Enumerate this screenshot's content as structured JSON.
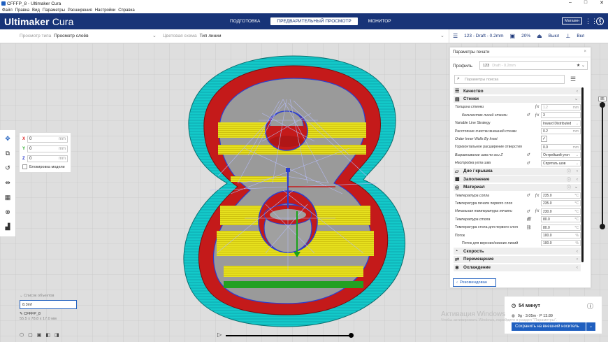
{
  "window": {
    "title": "CFFFP_8 - Ultimaker Cura",
    "controls": [
      "–",
      "□",
      "✕"
    ]
  },
  "menu": [
    "Файл",
    "Правка",
    "Вид",
    "Параметры",
    "Расширения",
    "Настройки",
    "Справка"
  ],
  "header": {
    "brand_main": "Ultimaker",
    "brand_sub": " Cura",
    "tabs": [
      "ПОДГОТОВКА",
      "ПРЕДВАРИТЕЛЬНЫЙ ПРОСМОТР",
      "МОНИТОР"
    ],
    "active_tab": 1,
    "marketplace": "Магазин",
    "account_initial": "E"
  },
  "toolbar": {
    "view_label": "Просмотр типа",
    "view_value": "Просмотр слоёв",
    "scheme_label": "Цветовая схема",
    "scheme_value": "Тип линии",
    "profile": "123 - Draft - 0.2mm",
    "infill": "20%",
    "support": "Выкл",
    "adhesion": "Вкл"
  },
  "move": {
    "x": "0",
    "y": "0",
    "z": "0",
    "unit": "mm",
    "lock_label": "Блокировка модели"
  },
  "objects": {
    "header": "Список объектов",
    "file": "8.3mf",
    "name": "CFFFP_8",
    "dims": "55.5 x 78.8 x 17.0 мм"
  },
  "layer_top": "85",
  "settings": {
    "title": "Параметры печати",
    "profile_label": "Профиль",
    "profile_value": "123",
    "profile_extra": "Draft - 0.2mm",
    "search_placeholder": "Параметры поиска",
    "recommended": "Рекомендован",
    "rows": [
      {
        "type": "cat",
        "icon": "☰",
        "label": "Качество"
      },
      {
        "type": "cat",
        "icon": "▤",
        "label": "Стенки",
        "open": true
      },
      {
        "type": "row",
        "label": "Толщина стенки",
        "italic": true,
        "fx": true,
        "value": "1.2",
        "unit": "mm",
        "disabled": true
      },
      {
        "type": "row",
        "label": "Количество линий стенки",
        "italic": true,
        "indent": true,
        "reset": true,
        "fx": true,
        "value": "3",
        "unit": ""
      },
      {
        "type": "row",
        "label": "Variable Line Strategy",
        "value": "Inward Distributed",
        "unit": "⌄"
      },
      {
        "type": "row",
        "label": "Расстояние очистки внешней стенки",
        "value": "0.2",
        "unit": "mm"
      },
      {
        "type": "row",
        "label": "Order Inner Walls By Inset",
        "italic": true,
        "check": true
      },
      {
        "type": "row",
        "label": "Горизонтальное расширение отверстия",
        "value": "0.0",
        "unit": "mm"
      },
      {
        "type": "row",
        "label": "Выравнивание шва по оси Z",
        "italic": true,
        "reset": true,
        "value": "Острейший угол",
        "unit": "⌄"
      },
      {
        "type": "row",
        "label": "Настройка угла шва",
        "italic": true,
        "reset": true,
        "value": "Спрятать шов",
        "unit": "⌄"
      },
      {
        "type": "cat",
        "icon": "▱",
        "label": "Дно / крышка",
        "info": true
      },
      {
        "type": "cat",
        "icon": "▩",
        "label": "Заполнение",
        "info": true
      },
      {
        "type": "cat",
        "icon": "◎",
        "label": "Материал",
        "info": true,
        "open": true
      },
      {
        "type": "row",
        "label": "Температура сопла",
        "italic": true,
        "reset": true,
        "fx": true,
        "value": "235.0",
        "unit": "°C"
      },
      {
        "type": "row",
        "label": "Температура печати первого слоя",
        "value": "235.0",
        "unit": "°C"
      },
      {
        "type": "row",
        "label": "Начальная температура печати",
        "italic": true,
        "reset": true,
        "fx": true,
        "value": "230.0",
        "unit": "°C"
      },
      {
        "type": "row",
        "label": "Температура стола",
        "italic": true,
        "reset": true,
        "link": true,
        "value": "80.0",
        "unit": "°C"
      },
      {
        "type": "row",
        "label": "Температура стола для первого слоя",
        "link": true,
        "value": "80.0",
        "unit": "°C"
      },
      {
        "type": "row",
        "label": "Поток",
        "value": "100.0",
        "unit": "%"
      },
      {
        "type": "row",
        "label": "Поток для верхних/нижних линий",
        "indent": true,
        "value": "100.0",
        "unit": "%"
      },
      {
        "type": "cat",
        "icon": "◔",
        "label": "Скорость"
      },
      {
        "type": "cat",
        "icon": "⇄",
        "label": "Перемещение"
      },
      {
        "type": "cat",
        "icon": "❄",
        "label": "Охлаждение"
      }
    ]
  },
  "print": {
    "time": "54 минут",
    "material": "9g · 3.05m · Р 13.89",
    "save": "Сохранить на внешний носитель"
  },
  "watermark": {
    "title": "Активация Windows",
    "sub": "Чтобы активировать Windows, перейдите в раздел \"Параметры\"."
  },
  "colors": {
    "brand": "#183478",
    "accent": "#1f5fbf",
    "shell": "#c41a1a",
    "skin": "#e5e022",
    "infill": "#f0a000",
    "travel": "#b0b6f0",
    "skirt": "#14c8c8"
  }
}
